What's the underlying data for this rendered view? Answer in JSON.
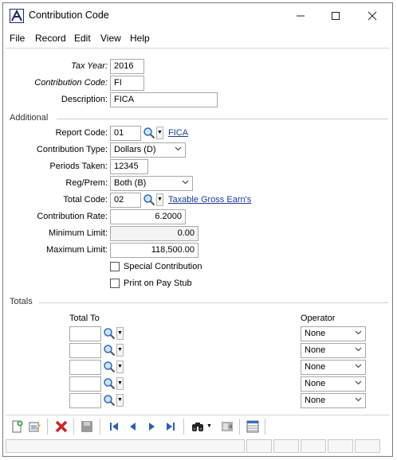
{
  "window": {
    "title": "Contribution Code"
  },
  "menu": [
    "File",
    "Record",
    "Edit",
    "View",
    "Help"
  ],
  "form": {
    "tax_year_label": "Tax Year:",
    "tax_year": "2016",
    "contribution_code_label": "Contribution Code:",
    "contribution_code": "FI",
    "description_label": "Description:",
    "description": "FICA",
    "additional_label": "Additional",
    "report_code_label": "Report Code:",
    "report_code": "01",
    "report_code_link": "FICA",
    "contribution_type_label": "Contribution Type:",
    "contribution_type": "Dollars (D)",
    "periods_taken_label": "Periods Taken:",
    "periods_taken": "12345",
    "reg_prem_label": "Reg/Prem:",
    "reg_prem": "Both (B)",
    "total_code_label": "Total Code:",
    "total_code": "02",
    "total_code_link": "Taxable Gross Earn's",
    "contribution_rate_label": "Contribution Rate:",
    "contribution_rate": "6.2000",
    "minimum_limit_label": "Minimum Limit:",
    "minimum_limit": "0.00",
    "maximum_limit_label": "Maximum Limit:",
    "maximum_limit": "118,500.00",
    "special_contribution_label": "Special Contribution",
    "print_on_pay_stub_label": "Print on Pay Stub"
  },
  "totals": {
    "section_label": "Totals",
    "total_to_header": "Total To",
    "operator_header": "Operator",
    "rows": [
      {
        "total_to": "",
        "operator": "None"
      },
      {
        "total_to": "",
        "operator": "None"
      },
      {
        "total_to": "",
        "operator": "None"
      },
      {
        "total_to": "",
        "operator": "None"
      },
      {
        "total_to": "",
        "operator": "None"
      }
    ]
  },
  "toolbar_icons": [
    "new-record-icon",
    "edit-record-icon",
    "delete-icon",
    "save-icon",
    "first-record-icon",
    "previous-record-icon",
    "next-record-icon",
    "last-record-icon",
    "find-icon",
    "find-dropdown-icon",
    "export-icon",
    "grid-view-icon"
  ],
  "colors": {
    "link": "#1a3a9b",
    "delete": "#d42020",
    "nav": "#2c5fb8"
  }
}
